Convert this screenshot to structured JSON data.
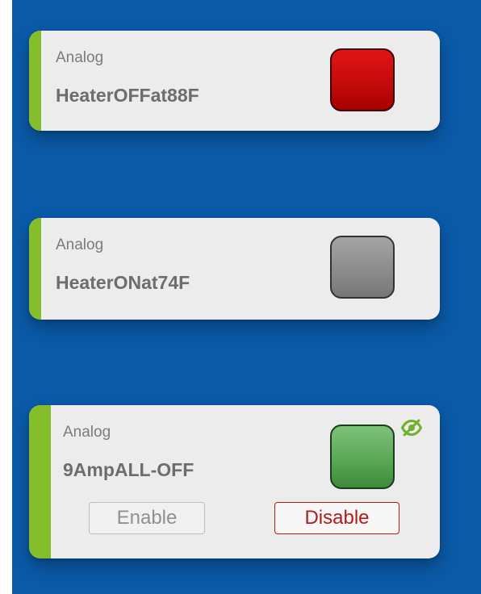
{
  "cards": [
    {
      "type": "Analog",
      "name": "HeaterOFFat88F",
      "status_color": "#d40f0f"
    },
    {
      "type": "Analog",
      "name": "HeaterONat74F",
      "status_color": "#8c8c8c"
    },
    {
      "type": "Analog",
      "name": "9AmpALL-OFF",
      "status_color": "#5aa956",
      "visibility_icon": "eye-off-icon",
      "enable_label": "Enable",
      "disable_label": "Disable"
    }
  ],
  "colors": {
    "panel_background": "#0a5aa8",
    "card_background": "#ececec",
    "accent": "#84be2a",
    "disable": "#b31b1b"
  }
}
